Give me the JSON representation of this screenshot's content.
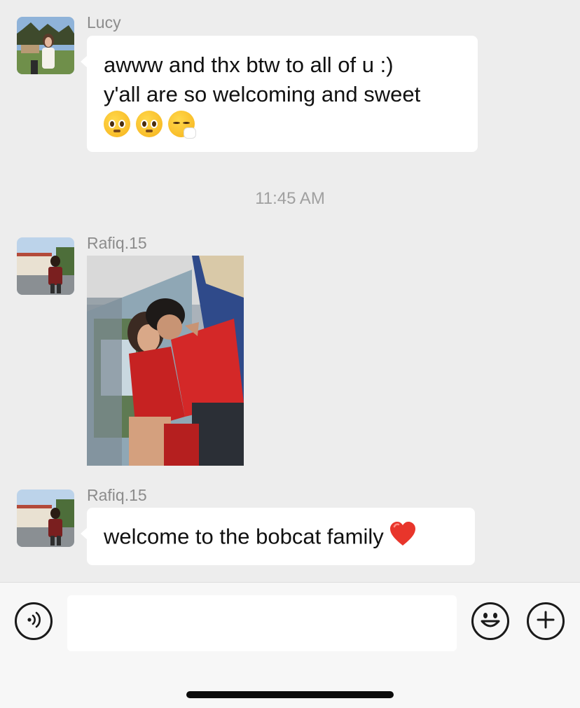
{
  "messages": [
    {
      "sender": "Lucy",
      "lines": [
        "awww and thx btw to all of u :)",
        "y'all are so welcoming and sweet"
      ],
      "emojis": [
        "pleading-face-emoji",
        "pleading-face-emoji",
        "sneezing-face-emoji"
      ]
    },
    {
      "sender": "Rafiq.15",
      "attachment": "photo"
    },
    {
      "sender": "Rafiq.15",
      "text": "welcome to the bobcat family",
      "emoji": "red-heart-emoji"
    }
  ],
  "timestamp": "11:45 AM",
  "input_bar": {
    "message_value": "",
    "icons": [
      "voice-icon",
      "emoji-icon",
      "plus-icon"
    ]
  },
  "colors": {
    "background": "#ededed",
    "bubble": "#ffffff",
    "sender_name": "#8c8c8c",
    "timestamp": "#a0a0a0"
  }
}
